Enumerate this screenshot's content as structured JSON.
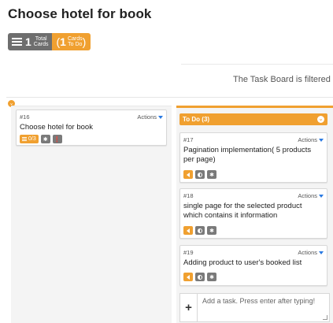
{
  "page": {
    "title": "Choose hotel for book"
  },
  "summary": {
    "total_count": "1",
    "total_label_line1": "Total",
    "total_label_line2": "Cards",
    "todo_open_paren": "(",
    "todo_count": "1",
    "todo_label_line1": "Cards",
    "todo_label_line2": "To Do",
    "todo_close_paren": ")"
  },
  "filter": {
    "note": "The Task Board is filtered and"
  },
  "story_card": {
    "id": "#16",
    "actions_label": "Actions",
    "title": "Choose hotel for book",
    "task_count": "0/3"
  },
  "todo_column": {
    "header": "To Do (3)",
    "cards": [
      {
        "id": "#17",
        "actions_label": "Actions",
        "title": "Pagination implementation( 5 products per page)"
      },
      {
        "id": "#18",
        "actions_label": "Actions",
        "title": "single page for the selected product which contains it information"
      },
      {
        "id": "#19",
        "actions_label": "Actions",
        "title": "Adding product to user's booked list"
      }
    ]
  },
  "add_task": {
    "plus": "+",
    "placeholder": "Add a task. Press enter after typing!"
  },
  "colors": {
    "accent": "#f0a030",
    "grey": "#6e6e6e",
    "link": "#2a7ae2"
  },
  "icons": [
    "list-icon",
    "asterisk-icon",
    "info-icon",
    "arrow-left-icon",
    "half-circle-icon",
    "chevron-down-icon"
  ]
}
